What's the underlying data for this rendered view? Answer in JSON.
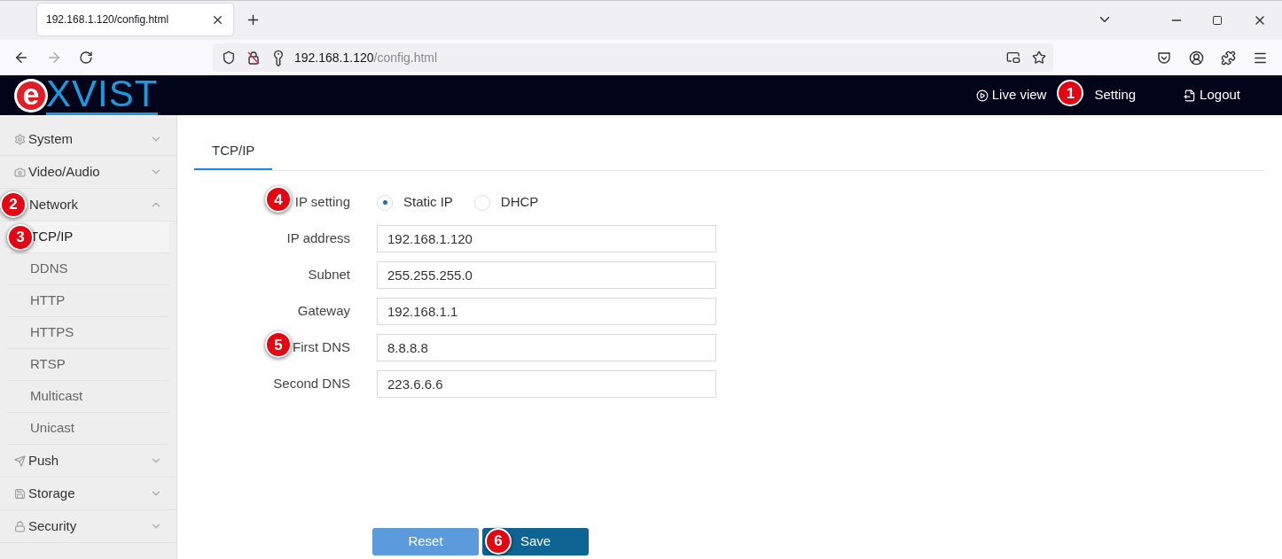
{
  "browser": {
    "tab_title": "192.168.1.120/config.html",
    "url_host": "192.168.1.120",
    "url_path": "/config.html"
  },
  "header": {
    "logo_mark": "e",
    "logo_text": "XVIST",
    "nav": [
      {
        "label": "Live view",
        "kind": "live"
      },
      {
        "label": "Setting",
        "kind": "plain",
        "callout": "1"
      },
      {
        "label": "Logout",
        "kind": "logout"
      }
    ]
  },
  "sidebar": {
    "items": [
      {
        "label": "System",
        "kind": "gear",
        "expanded": false
      },
      {
        "label": "Video/Audio",
        "kind": "camera",
        "expanded": false
      },
      {
        "label": "Network",
        "expanded": true,
        "callout": "2",
        "children": [
          {
            "label": "TCP/IP",
            "selected": true,
            "callout": "3"
          },
          {
            "label": "DDNS",
            "selected": false
          },
          {
            "label": "HTTP",
            "selected": false
          },
          {
            "label": "HTTPS",
            "selected": false
          },
          {
            "label": "RTSP",
            "selected": false
          },
          {
            "label": "Multicast",
            "selected": false
          },
          {
            "label": "Unicast",
            "selected": false
          }
        ]
      },
      {
        "label": "Push",
        "kind": "send",
        "expanded": false
      },
      {
        "label": "Storage",
        "kind": "disk",
        "expanded": false
      },
      {
        "label": "Security",
        "kind": "lock",
        "expanded": false
      }
    ]
  },
  "tabs": [
    {
      "label": "TCP/IP",
      "selected": true
    }
  ],
  "form": {
    "ip_setting": {
      "label": "IP setting",
      "callout": "4",
      "options": [
        {
          "label": "Static IP",
          "selected": true
        },
        {
          "label": "DHCP",
          "selected": false
        }
      ]
    },
    "fields": [
      {
        "label": "IP address",
        "value": "192.168.1.120"
      },
      {
        "label": "Subnet",
        "value": "255.255.255.0"
      },
      {
        "label": "Gateway",
        "value": "192.168.1.1"
      },
      {
        "label": "First DNS",
        "value": "8.8.8.8",
        "callout": "5"
      },
      {
        "label": "Second DNS",
        "value": "223.6.6.6"
      }
    ]
  },
  "buttons": [
    {
      "label": "Reset",
      "kind": "secondary"
    },
    {
      "label": "Save",
      "kind": "primary",
      "callout": "6"
    }
  ]
}
